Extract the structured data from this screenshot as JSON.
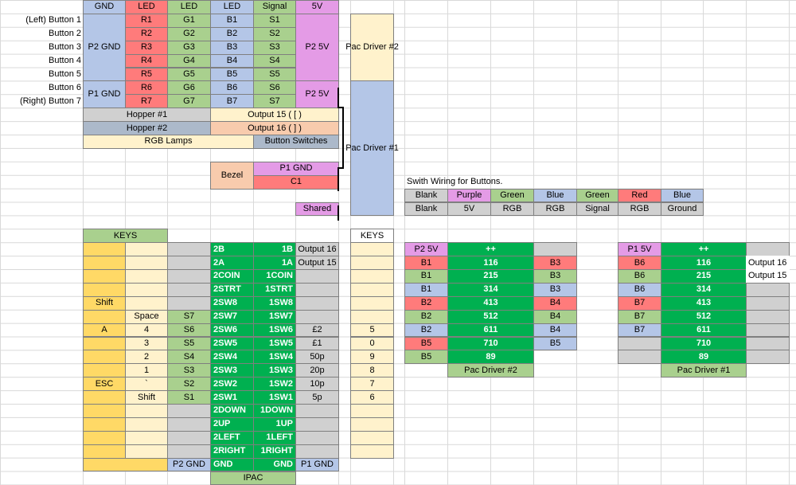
{
  "colors": {
    "gnd": "#b4c6e7",
    "red": "#ff7b7b",
    "green": "#a9d08e",
    "blue": "#b4c6e7",
    "pink": "#e49be6",
    "cream": "#fff2cc",
    "gray": "#d0d0d0",
    "darkgray": "#acb9ca",
    "peach": "#f8cbad",
    "orange": "#ffd966",
    "dkgreen": "#00b050",
    "gridline": "#d9d9d9"
  },
  "top": {
    "headers": [
      "GND",
      "LED",
      "LED",
      "LED",
      "Signal",
      "5V"
    ],
    "button_labels": [
      "(Left) Button 1",
      "Button 2",
      "Button 3",
      "Button 4",
      "Button 5",
      "Button 6",
      "(Right) Button 7"
    ],
    "p2_gnd": "P2 GND",
    "p1_gnd": "P1 GND",
    "p2_5v": "P2 5V",
    "p1_5v_top": "P2 5V",
    "red_col": [
      "R1",
      "R2",
      "R3",
      "R4",
      "R5",
      "R6",
      "R7"
    ],
    "green_col": [
      "G1",
      "G2",
      "G3",
      "G4",
      "G5",
      "G6",
      "G7"
    ],
    "blue_col": [
      "B1",
      "B2",
      "B3",
      "B4",
      "B5",
      "B6",
      "B7"
    ],
    "signal_col": [
      "S1",
      "S2",
      "S3",
      "S4",
      "S5",
      "S6",
      "S7"
    ],
    "hopper1": "Hopper #1",
    "hopper2": "Hopper #2",
    "output15": "Output 15 ( [ )",
    "output16": "Output 16 ( ] )",
    "rgb_lamps": "RGB Lamps",
    "button_switches": "Button Switches",
    "bezel": "Bezel",
    "p1_gnd_bezel": "P1 GND",
    "c1": "C1",
    "shared": "Shared",
    "pac_driver_2": "Pac Driver #2",
    "pac_driver_1": "Pac Driver #1"
  },
  "wiring": {
    "title": "Swith Wiring for Buttons.",
    "row1": [
      "Blank",
      "Purple",
      "Green",
      "Blue",
      "Green",
      "Red",
      "Blue"
    ],
    "row2": [
      "Blank",
      "5V",
      "RGB",
      "RGB",
      "Signal",
      "RGB",
      "Ground"
    ]
  },
  "ipac": {
    "keys_header": "KEYS",
    "keys_header_right": "KEYS",
    "footer": "IPAC",
    "p2_gnd": "P2 GND",
    "p1_gnd": "P1 GND",
    "rows": [
      {
        "k1": "",
        "k2": "",
        "s": "",
        "l": "2B",
        "r": "1B",
        "o": "Output 16",
        "kr": ""
      },
      {
        "k1": "",
        "k2": "",
        "s": "",
        "l": "2A",
        "r": "1A",
        "o": "Output 15",
        "kr": ""
      },
      {
        "k1": "",
        "k2": "",
        "s": "",
        "l": "2COIN",
        "r": "1COIN",
        "o": "",
        "kr": ""
      },
      {
        "k1": "",
        "k2": "",
        "s": "",
        "l": "2STRT",
        "r": "1STRT",
        "o": "",
        "kr": ""
      },
      {
        "k1": "Shift",
        "k2": "",
        "s": "",
        "l": "2SW8",
        "r": "1SW8",
        "o": "",
        "kr": ""
      },
      {
        "k1": "",
        "k2": "Space",
        "s": "S7",
        "l": "2SW7",
        "r": "1SW7",
        "o": "",
        "kr": ""
      },
      {
        "k1": "A",
        "k2": "4",
        "s": "S6",
        "l": "2SW6",
        "r": "1SW6",
        "o": "£2",
        "kr": "5"
      },
      {
        "k1": "",
        "k2": "3",
        "s": "S5",
        "l": "2SW5",
        "r": "1SW5",
        "o": "£1",
        "kr": "0"
      },
      {
        "k1": "",
        "k2": "2",
        "s": "S4",
        "l": "2SW4",
        "r": "1SW4",
        "o": "50p",
        "kr": "9"
      },
      {
        "k1": "",
        "k2": "1",
        "s": "S3",
        "l": "2SW3",
        "r": "1SW3",
        "o": "20p",
        "kr": "8"
      },
      {
        "k1": "ESC",
        "k2": "`",
        "s": "S2",
        "l": "2SW2",
        "r": "1SW2",
        "o": "10p",
        "kr": "7"
      },
      {
        "k1": "",
        "k2": "Shift",
        "s": "S1",
        "l": "2SW1",
        "r": "1SW1",
        "o": "5p",
        "kr": "6"
      },
      {
        "k1": "",
        "k2": "",
        "s": "",
        "l": "2DOWN",
        "r": "1DOWN",
        "o": "",
        "kr": ""
      },
      {
        "k1": "",
        "k2": "",
        "s": "",
        "l": "2UP",
        "r": "1UP",
        "o": "",
        "kr": ""
      },
      {
        "k1": "",
        "k2": "",
        "s": "",
        "l": "2LEFT",
        "r": "1LEFT",
        "o": "",
        "kr": ""
      },
      {
        "k1": "",
        "k2": "",
        "s": "",
        "l": "2RIGHT",
        "r": "1RIGHT",
        "o": "",
        "kr": ""
      },
      {
        "k1": "",
        "k2": "",
        "s": "",
        "l": "GND",
        "r": "GND",
        "o": "",
        "kr": ""
      }
    ]
  },
  "pd2": {
    "header": "P2 5V",
    "plus": "+",
    "footer": "Pac Driver #2",
    "rows": [
      {
        "b": "B1",
        "l": "1",
        "r": "16",
        "x": "B3",
        "bc": "red",
        "xc": "red"
      },
      {
        "b": "B1",
        "l": "2",
        "r": "15",
        "x": "B3",
        "bc": "green",
        "xc": "green"
      },
      {
        "b": "B1",
        "l": "3",
        "r": "14",
        "x": "B3",
        "bc": "blue",
        "xc": "blue"
      },
      {
        "b": "B2",
        "l": "4",
        "r": "13",
        "x": "B4",
        "bc": "red",
        "xc": "red"
      },
      {
        "b": "B2",
        "l": "5",
        "r": "12",
        "x": "B4",
        "bc": "green",
        "xc": "green"
      },
      {
        "b": "B2",
        "l": "6",
        "r": "11",
        "x": "B4",
        "bc": "blue",
        "xc": "blue"
      },
      {
        "b": "B5",
        "l": "7",
        "r": "10",
        "x": "B5",
        "bc": "red",
        "xc": "blue"
      },
      {
        "b": "B5",
        "l": "8",
        "r": "9",
        "x": "",
        "bc": "green",
        "xc": "none"
      }
    ]
  },
  "pd1": {
    "header": "P1 5V",
    "plus": "+",
    "footer": "Pac Driver #1",
    "rows": [
      {
        "b": "B6",
        "l": "1",
        "r": "16",
        "x": "Output 16",
        "bc": "red"
      },
      {
        "b": "B6",
        "l": "2",
        "r": "15",
        "x": "Output 15",
        "bc": "green"
      },
      {
        "b": "B6",
        "l": "3",
        "r": "14",
        "x": "",
        "bc": "blue"
      },
      {
        "b": "B7",
        "l": "4",
        "r": "13",
        "x": "",
        "bc": "red"
      },
      {
        "b": "B7",
        "l": "5",
        "r": "12",
        "x": "",
        "bc": "green"
      },
      {
        "b": "B7",
        "l": "6",
        "r": "11",
        "x": "",
        "bc": "blue"
      },
      {
        "b": "",
        "l": "7",
        "r": "10",
        "x": "",
        "bc": "gray"
      },
      {
        "b": "",
        "l": "8",
        "r": "9",
        "x": "",
        "bc": "gray"
      }
    ]
  }
}
